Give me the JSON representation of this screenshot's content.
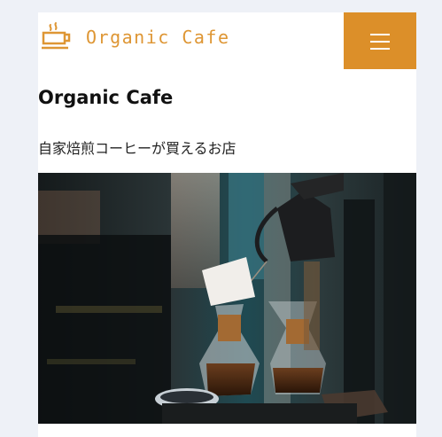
{
  "header": {
    "logo_text": "Organic Cafe",
    "logo_icon": "coffee-cup-icon",
    "menu_icon": "hamburger-menu-icon"
  },
  "main": {
    "title": "Organic Cafe",
    "tagline": "自家焙煎コーヒーが買えるお店",
    "hero_image": "pour-over-coffee-photo"
  },
  "colors": {
    "accent": "#dc8f29",
    "logo_text": "#de9634",
    "background": "#eef1f7"
  }
}
